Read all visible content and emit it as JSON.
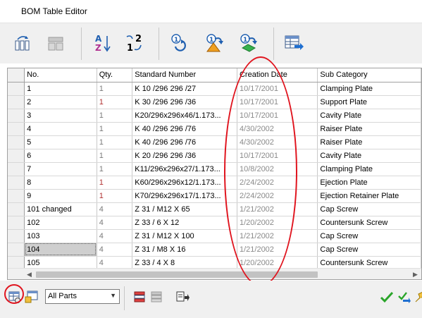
{
  "window": {
    "title": "BOM Table Editor"
  },
  "toolbar": {
    "buttons": [
      {
        "name": "insert-column-icon"
      },
      {
        "name": "delete-column-icon"
      },
      {
        "name": "sort-az-icon"
      },
      {
        "name": "sort-numeric-icon"
      },
      {
        "name": "refresh-part-icon"
      },
      {
        "name": "update-part-icon"
      },
      {
        "name": "replace-part-icon"
      },
      {
        "name": "export-table-icon"
      }
    ]
  },
  "grid": {
    "headers": [
      "No.",
      "Qty.",
      "Standard Number",
      "Creation Date",
      "Sub Category"
    ],
    "rows": [
      {
        "no": "1",
        "qty": "1",
        "std": "K 10 /296 296 /27",
        "date": "10/17/2001",
        "sub": "Clamping Plate",
        "qtyRed": false
      },
      {
        "no": "2",
        "qty": "1",
        "std": "K 30 /296 296 /36",
        "date": "10/17/2001",
        "sub": "Support Plate",
        "qtyRed": true
      },
      {
        "no": "3",
        "qty": "1",
        "std": "K20/296x296x46/1.173...",
        "date": "10/17/2001",
        "sub": "Cavity Plate",
        "qtyRed": false
      },
      {
        "no": "4",
        "qty": "1",
        "std": "K 40 /296 296 /76",
        "date": "4/30/2002",
        "sub": "Raiser Plate",
        "qtyRed": false
      },
      {
        "no": "5",
        "qty": "1",
        "std": "K 40 /296 296 /76",
        "date": "4/30/2002",
        "sub": "Raiser Plate",
        "qtyRed": false
      },
      {
        "no": "6",
        "qty": "1",
        "std": "K 20 /296 296 /36",
        "date": "10/17/2001",
        "sub": "Cavity Plate",
        "qtyRed": false
      },
      {
        "no": "7",
        "qty": "1",
        "std": "K11/296x296x27/1.173...",
        "date": "10/8/2002",
        "sub": "Clamping Plate",
        "qtyRed": false
      },
      {
        "no": "8",
        "qty": "1",
        "std": "K60/296x296x12/1.173...",
        "date": "2/24/2002",
        "sub": "Ejection Plate",
        "qtyRed": true
      },
      {
        "no": "9",
        "qty": "1",
        "std": "K70/296x296x17/1.173...",
        "date": "2/24/2002",
        "sub": "Ejection Retainer Plate",
        "qtyRed": true
      },
      {
        "no": "101 changed",
        "qty": "4",
        "std": "Z 31 / M12 X 65",
        "date": "1/21/2002",
        "sub": "Cap Screw",
        "qtyRed": false
      },
      {
        "no": "102",
        "qty": "4",
        "std": "Z 33 / 6 X 12",
        "date": "1/20/2002",
        "sub": "Countersunk Screw",
        "qtyRed": false
      },
      {
        "no": "103",
        "qty": "4",
        "std": "Z 31 / M12 X 100",
        "date": "1/21/2002",
        "sub": "Cap Screw",
        "qtyRed": false
      },
      {
        "no": "104",
        "qty": "4",
        "std": "Z 31 / M8 X 16",
        "date": "1/21/2002",
        "sub": "Cap Screw",
        "qtyRed": false
      },
      {
        "no": "105",
        "qty": "4",
        "std": "Z 33 / 4 X 8",
        "date": "1/20/2002",
        "sub": "Countersunk Screw",
        "qtyRed": false
      }
    ],
    "selected_row": 12
  },
  "filter": {
    "selected": "All Parts"
  },
  "colors": {
    "annotation": "#e0141e",
    "ok": "#2aa52a"
  }
}
